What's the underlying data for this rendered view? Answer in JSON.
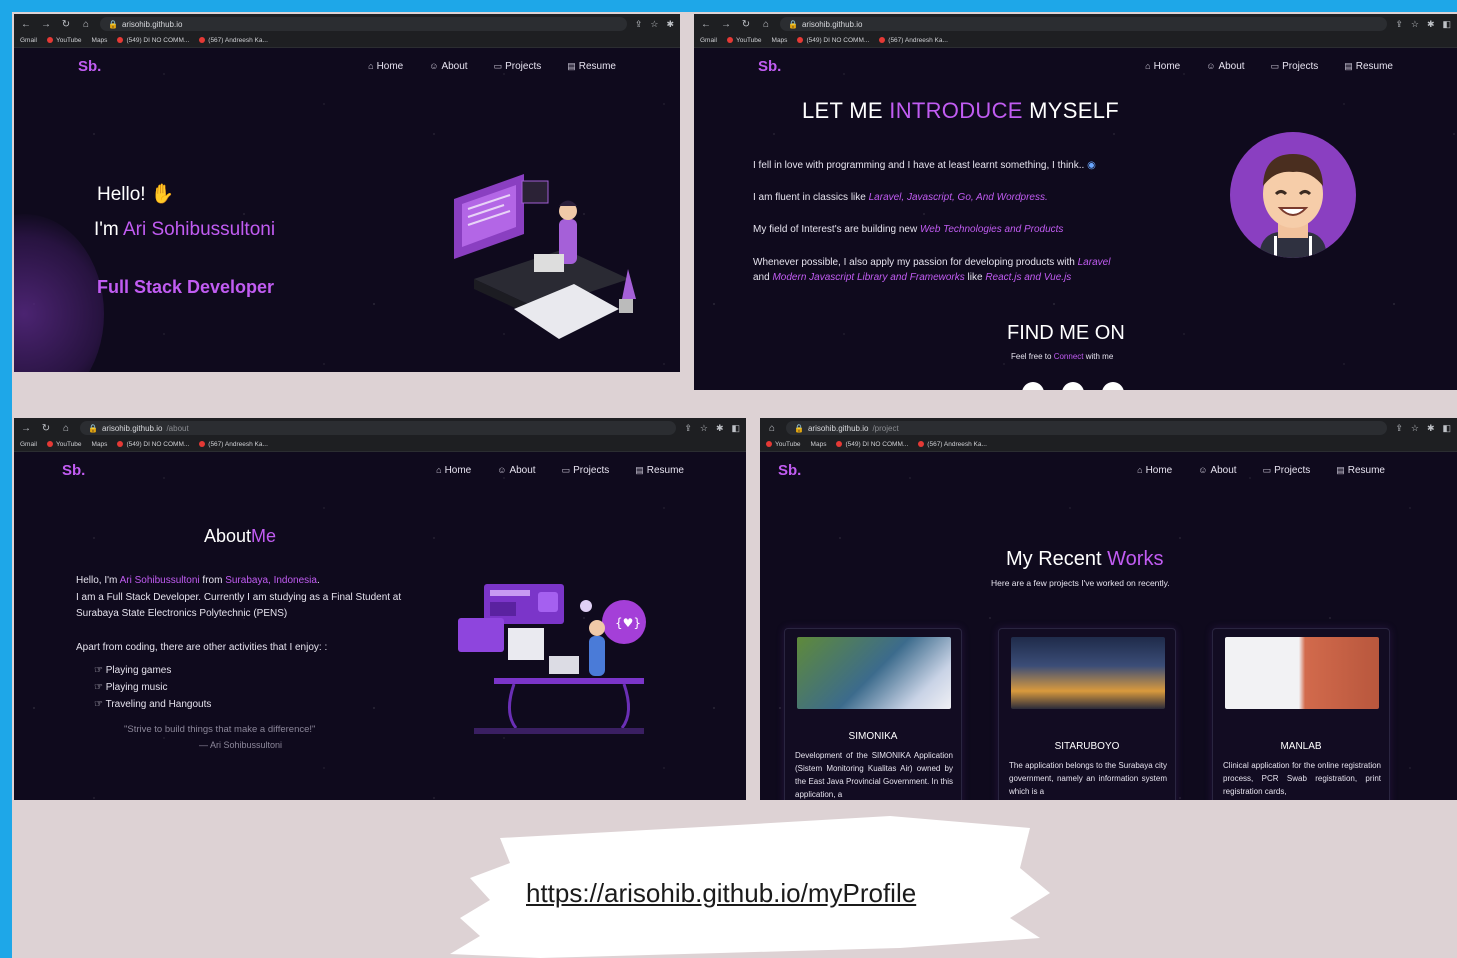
{
  "colors": {
    "accent": "#c15cf2",
    "frame": "#1ea7e8",
    "background": "#ddd2d4",
    "site_bg": "#0f0a1d"
  },
  "nav": {
    "logo": "Sb.",
    "home": "Home",
    "about": "About",
    "projects": "Projects",
    "resume": "Resume"
  },
  "shot1": {
    "url_host": "arisohib.github.io",
    "bookmarks": [
      "Gmail",
      "YouTube",
      "Maps",
      "(549) DI NO COMM...",
      "(567) Andreesh Ka..."
    ],
    "hello": "Hello!",
    "wave_icon": "waving-hand-icon",
    "im_prefix": "I'm ",
    "name": "Ari Sohibussultoni",
    "role": "Full Stack Developer"
  },
  "shot2": {
    "url_host": "arisohib.github.io",
    "bookmarks": [
      "Gmail",
      "YouTube",
      "Maps",
      "(549) DI NO COMM...",
      "(567) Andreesh Ka..."
    ],
    "title_a": "LET ME ",
    "title_b": "INTRODUCE",
    "title_c": " MYSELF",
    "p1": "I fell in love with programming and I have at least learnt something, I think.. ",
    "p2_a": "I am fluent in classics like ",
    "p2_b": "Laravel, Javascript, Go, And Wordpress.",
    "p3_a": "My field of Interest's are building new ",
    "p3_b": "Web Technologies and Products",
    "p4_a": "Whenever possible, I also apply my passion for developing products with ",
    "p4_b": "Laravel",
    "p4_c": "and ",
    "p4_d": "Modern Javascript Library and Frameworks",
    "p4_e": " like ",
    "p4_f": "React.js and Vue.js",
    "find_title": "FIND ME ON",
    "find_sub_a": "Feel free to ",
    "find_sub_b": "Connect",
    "find_sub_c": " with me"
  },
  "shot3": {
    "url_host": "arisohib.github.io",
    "url_path": "/about",
    "bookmarks": [
      "Gmail",
      "YouTube",
      "Maps",
      "(549) DI NO COMM...",
      "(567) Andreesh Ka..."
    ],
    "title_a": "About",
    "title_b": "Me",
    "p1_a": "Hello, I'm ",
    "p1_b": "Ari Sohibussultoni",
    "p1_c": " from ",
    "p1_d": "Surabaya, Indonesia",
    "p1_e": ".",
    "p2": "I am a Full Stack Developer. Currently I am studying as a Final Student at Surabaya State Electronics Polytechnic (PENS)",
    "p3": "Apart from coding, there are other activities that I enjoy: :",
    "activities": [
      "Playing games",
      "Playing music",
      "Traveling and Hangouts"
    ],
    "quote": "\"Strive to build things that make a difference!\"",
    "quote_author": "— Ari Sohibussultoni"
  },
  "shot4": {
    "url_host": "arisohib.github.io",
    "url_path": "/project",
    "bookmarks": [
      "YouTube",
      "Maps",
      "(549) DI NO COMM...",
      "(567) Andreesh Ka..."
    ],
    "title_a": "My Recent ",
    "title_b": "Works",
    "subtitle": "Here are a few projects I've worked on recently.",
    "cards": [
      {
        "title": "SIMONIKA",
        "desc": "Development of the SIMONIKA Application (Sistem Monitoring Kualitas Air) owned by the East Java Provincial Government. In this application, a"
      },
      {
        "title": "SITARUBOYO",
        "desc": "The application belongs to the Surabaya city government, namely an information system which is a"
      },
      {
        "title": "MANLAB",
        "desc": "Clinical application for the online registration process, PCR Swab registration, print registration cards,"
      }
    ]
  },
  "footer": {
    "url": "https://arisohib.github.io/myProfile"
  }
}
